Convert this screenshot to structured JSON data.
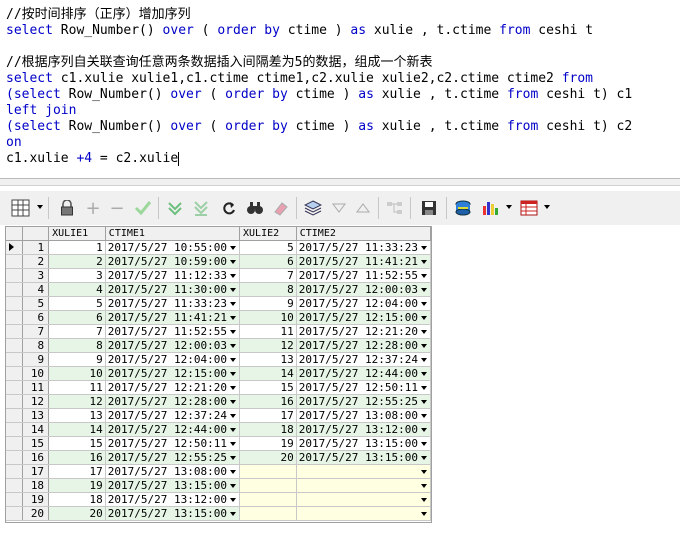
{
  "editor": {
    "lines": [
      "//按时间排序（正序）增加序列",
      "select Row_Number() over ( order by ctime ) as xulie , t.ctime from ceshi t",
      "",
      "//根据序列自关联查询任意两条数据插入间隔差为5的数据，组成一个新表",
      "select c1.xulie xulie1,c1.ctime ctime1,c2.xulie xulie2,c2.ctime ctime2 from",
      "(select Row_Number() over ( order by ctime ) as xulie , t.ctime from ceshi t) c1",
      "left join",
      "(select Row_Number() over ( order by ctime ) as xulie , t.ctime from ceshi t) c2",
      "on",
      "c1.xulie +4 = c2.xulie"
    ]
  },
  "toolbar": {
    "icons": [
      "grid-menu-icon",
      "lock-icon",
      "add-icon",
      "delete-icon",
      "post-icon",
      "next-record-icon",
      "last-record-icon",
      "refresh-icon",
      "find-icon",
      "clear-icon",
      "query-icon",
      "sort-desc-icon",
      "sort-asc-icon",
      "tree-icon",
      "save-icon",
      "export-icon",
      "chart-icon",
      "table-icon"
    ]
  },
  "grid": {
    "columns": [
      "",
      "",
      "XULIE1",
      "CTIME1",
      "XULIE2",
      "CTIME2"
    ],
    "rows": [
      {
        "rn": "1",
        "x1": "1",
        "c1": "2017/5/27 10:55:00",
        "x2": "5",
        "c2": "2017/5/27 11:33:23"
      },
      {
        "rn": "2",
        "x1": "2",
        "c1": "2017/5/27 10:59:00",
        "x2": "6",
        "c2": "2017/5/27 11:41:21"
      },
      {
        "rn": "3",
        "x1": "3",
        "c1": "2017/5/27 11:12:33",
        "x2": "7",
        "c2": "2017/5/27 11:52:55"
      },
      {
        "rn": "4",
        "x1": "4",
        "c1": "2017/5/27 11:30:00",
        "x2": "8",
        "c2": "2017/5/27 12:00:03"
      },
      {
        "rn": "5",
        "x1": "5",
        "c1": "2017/5/27 11:33:23",
        "x2": "9",
        "c2": "2017/5/27 12:04:00"
      },
      {
        "rn": "6",
        "x1": "6",
        "c1": "2017/5/27 11:41:21",
        "x2": "10",
        "c2": "2017/5/27 12:15:00"
      },
      {
        "rn": "7",
        "x1": "7",
        "c1": "2017/5/27 11:52:55",
        "x2": "11",
        "c2": "2017/5/27 12:21:20"
      },
      {
        "rn": "8",
        "x1": "8",
        "c1": "2017/5/27 12:00:03",
        "x2": "12",
        "c2": "2017/5/27 12:28:00"
      },
      {
        "rn": "9",
        "x1": "9",
        "c1": "2017/5/27 12:04:00",
        "x2": "13",
        "c2": "2017/5/27 12:37:24"
      },
      {
        "rn": "10",
        "x1": "10",
        "c1": "2017/5/27 12:15:00",
        "x2": "14",
        "c2": "2017/5/27 12:44:00"
      },
      {
        "rn": "11",
        "x1": "11",
        "c1": "2017/5/27 12:21:20",
        "x2": "15",
        "c2": "2017/5/27 12:50:11"
      },
      {
        "rn": "12",
        "x1": "12",
        "c1": "2017/5/27 12:28:00",
        "x2": "16",
        "c2": "2017/5/27 12:55:25"
      },
      {
        "rn": "13",
        "x1": "13",
        "c1": "2017/5/27 12:37:24",
        "x2": "17",
        "c2": "2017/5/27 13:08:00"
      },
      {
        "rn": "14",
        "x1": "14",
        "c1": "2017/5/27 12:44:00",
        "x2": "18",
        "c2": "2017/5/27 13:12:00"
      },
      {
        "rn": "15",
        "x1": "15",
        "c1": "2017/5/27 12:50:11",
        "x2": "19",
        "c2": "2017/5/27 13:15:00"
      },
      {
        "rn": "16",
        "x1": "16",
        "c1": "2017/5/27 12:55:25",
        "x2": "20",
        "c2": "2017/5/27 13:15:00"
      },
      {
        "rn": "17",
        "x1": "17",
        "c1": "2017/5/27 13:08:00",
        "x2": "",
        "c2": ""
      },
      {
        "rn": "18",
        "x1": "19",
        "c1": "2017/5/27 13:15:00",
        "x2": "",
        "c2": ""
      },
      {
        "rn": "19",
        "x1": "18",
        "c1": "2017/5/27 13:12:00",
        "x2": "",
        "c2": ""
      },
      {
        "rn": "20",
        "x1": "20",
        "c1": "2017/5/27 13:15:00",
        "x2": "",
        "c2": ""
      }
    ]
  }
}
